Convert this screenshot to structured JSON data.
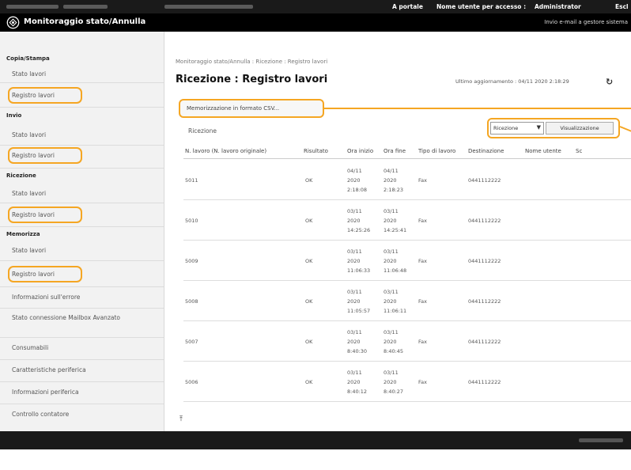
{
  "header": {
    "portal_link": "A portale",
    "user_label": "Nome utente per accesso :",
    "user_name": "Administrator",
    "logout": "Escl"
  },
  "titlebar": {
    "title": "Monitoraggio stato/Annulla",
    "mail_link": "Invio e-mail a gestore sistema"
  },
  "sidebar": {
    "copy": {
      "heading": "Copia/Stampa",
      "items": [
        "Stato lavori",
        "Registro lavori"
      ]
    },
    "send": {
      "heading": "Invio",
      "items": [
        "Stato lavori",
        "Registro lavori"
      ]
    },
    "receive": {
      "heading": "Ricezione",
      "items": [
        "Stato lavori",
        "Registro lavori"
      ]
    },
    "store": {
      "heading": "Memorizza",
      "items": [
        "Stato lavori",
        "Registro lavori"
      ]
    },
    "other": [
      "Informazioni sull'errore",
      "Stato connessione Mailbox Avanzato",
      "Consumabili",
      "Caratteristiche periferica",
      "Informazioni periferica",
      "Controllo contatore"
    ]
  },
  "main": {
    "breadcrumb": "Monitoraggio stato/Annulla : Ricezione : Registro lavori",
    "title": "Ricezione : Registro lavori",
    "last_update": "Ultimo aggiornamento : 04/11 2020 2:18:29",
    "csv_button": "Memorizzazione in formato CSV...",
    "section_label": "Ricezione",
    "select_value": "Ricezione",
    "view_button": "Visualizzazione"
  },
  "table": {
    "columns": [
      "N. lavoro (N. lavoro originale)",
      "Risultato",
      "Ora inizio",
      "Ora fine",
      "Tipo di lavoro",
      "Destinazione",
      "Nome utente",
      "Sc"
    ],
    "rows": [
      {
        "job": "5011",
        "result": "OK",
        "start": [
          "04/11",
          "2020",
          "2:18:08"
        ],
        "end": [
          "04/11",
          "2020",
          "2:18:23"
        ],
        "type": "Fax",
        "dest": "0441112222"
      },
      {
        "job": "5010",
        "result": "OK",
        "start": [
          "03/11",
          "2020",
          "14:25:26"
        ],
        "end": [
          "03/11",
          "2020",
          "14:25:41"
        ],
        "type": "Fax",
        "dest": "0441112222"
      },
      {
        "job": "5009",
        "result": "OK",
        "start": [
          "03/11",
          "2020",
          "11:06:33"
        ],
        "end": [
          "03/11",
          "2020",
          "11:06:48"
        ],
        "type": "Fax",
        "dest": "0441112222"
      },
      {
        "job": "5008",
        "result": "OK",
        "start": [
          "03/11",
          "2020",
          "11:05:57"
        ],
        "end": [
          "03/11",
          "2020",
          "11:06:11"
        ],
        "type": "Fax",
        "dest": "0441112222"
      },
      {
        "job": "5007",
        "result": "OK",
        "start": [
          "03/11",
          "2020",
          "8:40:30"
        ],
        "end": [
          "03/11",
          "2020",
          "8:40:45"
        ],
        "type": "Fax",
        "dest": "0441112222"
      },
      {
        "job": "5006",
        "result": "OK",
        "start": [
          "03/11",
          "2020",
          "8:40:12"
        ],
        "end": [
          "03/11",
          "2020",
          "8:40:27"
        ],
        "type": "Fax",
        "dest": "0441112222"
      }
    ]
  },
  "colors": {
    "highlight": "#f5a623",
    "topbar": "#1a1a1a",
    "titlebar": "#000000",
    "sidebar": "#f2f2f2"
  },
  "icons": {
    "app": "monitor-icon",
    "refresh": "refresh-icon",
    "top": "page-top-icon"
  }
}
